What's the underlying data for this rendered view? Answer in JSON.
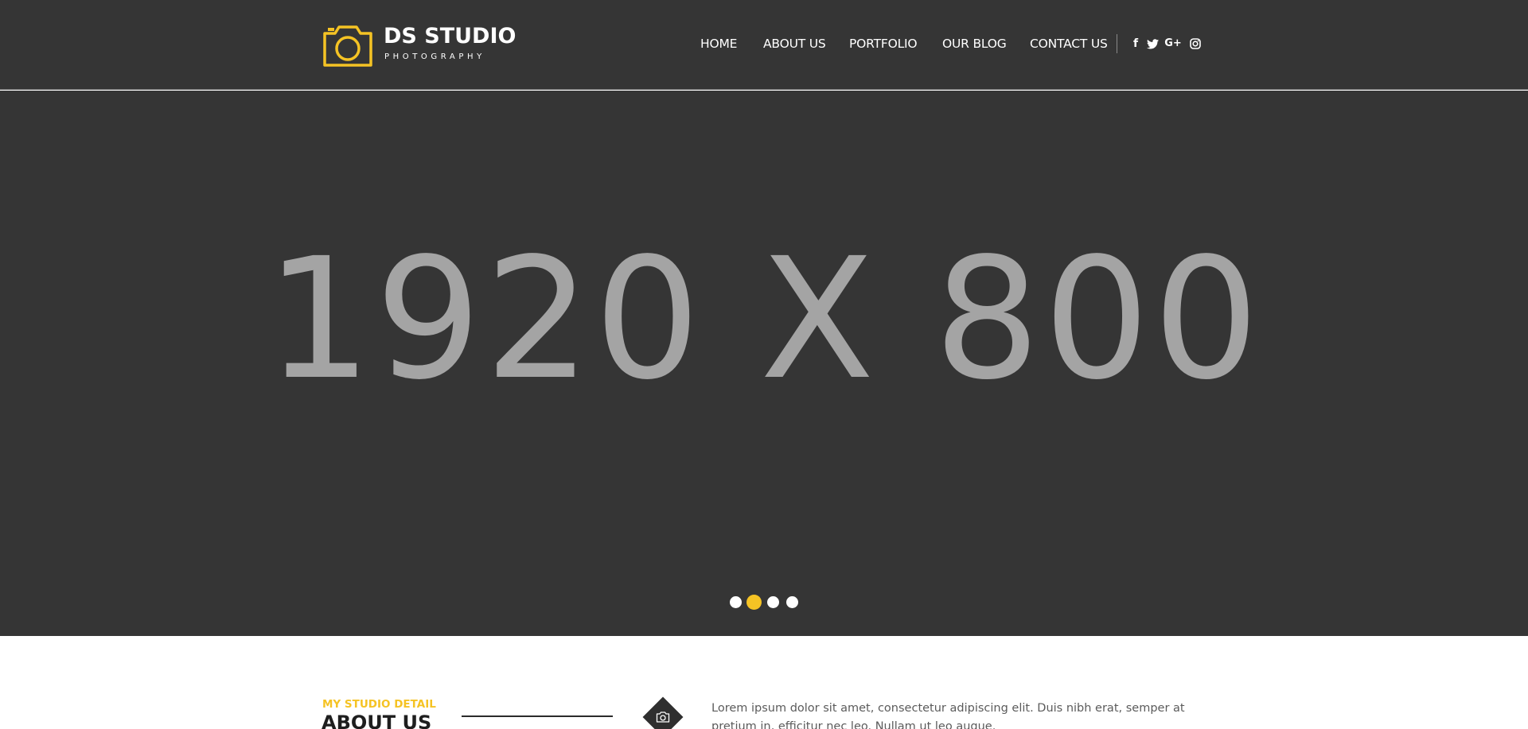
{
  "brand": {
    "title": "DS STUDIO",
    "subtitle": "PHOTOGRAPHY",
    "icon": "camera-outline-icon",
    "accent_color": "#f5c324"
  },
  "nav": {
    "items": [
      {
        "label": "HOME"
      },
      {
        "label": "ABOUT US"
      },
      {
        "label": "PORTFOLIO"
      },
      {
        "label": "OUR BLOG"
      },
      {
        "label": "CONTACT US"
      }
    ],
    "social": [
      {
        "name": "facebook-icon",
        "glyph": "f"
      },
      {
        "name": "twitter-icon",
        "glyph": "twitter"
      },
      {
        "name": "google-plus-icon",
        "glyph": "G+"
      },
      {
        "name": "instagram-icon",
        "glyph": "instagram"
      }
    ]
  },
  "hero": {
    "placeholder_text": "1920 X 800",
    "background_color": "#353535",
    "slides_count": 4,
    "active_slide": 2
  },
  "about": {
    "kicker": "MY STUDIO DETAIL",
    "title": "ABOUT US",
    "icon": "camera-icon",
    "text": "Lorem ipsum dolor sit amet, consectetur adipiscing elit. Duis nibh erat, semper at pretium in, efficitur nec leo. Nullam ut leo augue."
  }
}
